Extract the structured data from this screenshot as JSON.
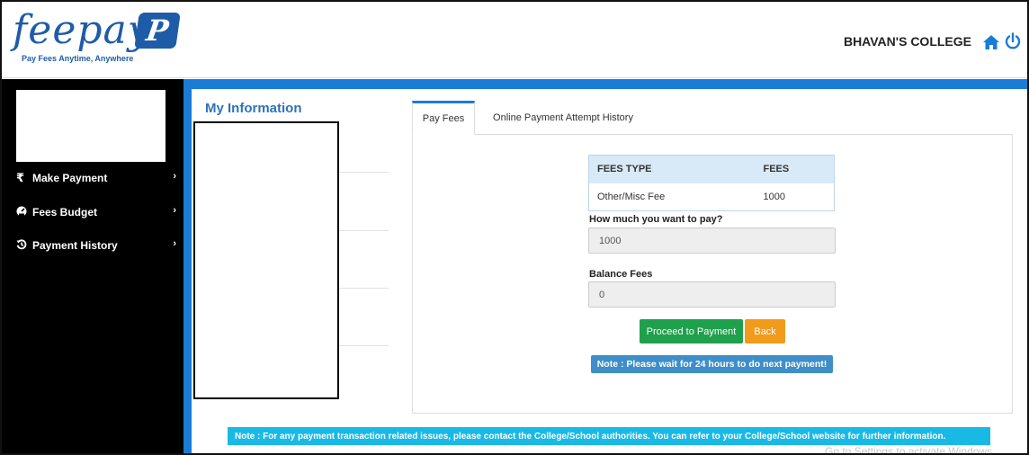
{
  "header": {
    "logo_text": "feepayr",
    "logo_badge": "P",
    "logo_tagline": "Pay Fees Anytime, Anywhere",
    "college_name": "BHAVAN'S COLLEGE",
    "brand_color": "#1f5ca8"
  },
  "sidebar": {
    "items": [
      {
        "label": "Make Payment",
        "icon": "rupee-icon"
      },
      {
        "label": "Fees Budget",
        "icon": "gauge-icon"
      },
      {
        "label": "Payment History",
        "icon": "history-icon"
      }
    ]
  },
  "main": {
    "section_title": "My Information",
    "tabs": [
      {
        "label": "Pay Fees",
        "active": true
      },
      {
        "label": "Online Payment Attempt History",
        "active": false
      }
    ],
    "fees_table": {
      "headers": [
        "FEES TYPE",
        "FEES"
      ],
      "rows": [
        [
          "Other/Misc Fee",
          "1000"
        ]
      ]
    },
    "pay_amount": {
      "label": "How much you want to pay?",
      "value": "1000"
    },
    "balance": {
      "label": "Balance Fees",
      "value": "0"
    },
    "proceed_label": "Proceed to Payment",
    "back_label": "Back",
    "wait_note": "Note : Please wait for 24 hours to do next payment!",
    "footer_note": "Note : For any payment transaction related issues, please contact the College/School authorities. You can refer to your College/School website for further information."
  },
  "os_watermark": "Go to Settings to activate Windows.",
  "colors": {
    "accent_blue": "#1a7cd6",
    "proceed_green": "#1fa04c",
    "back_orange": "#f29a1c",
    "note_blue": "#3e8ec9",
    "footer_cyan": "#19b9e6"
  }
}
